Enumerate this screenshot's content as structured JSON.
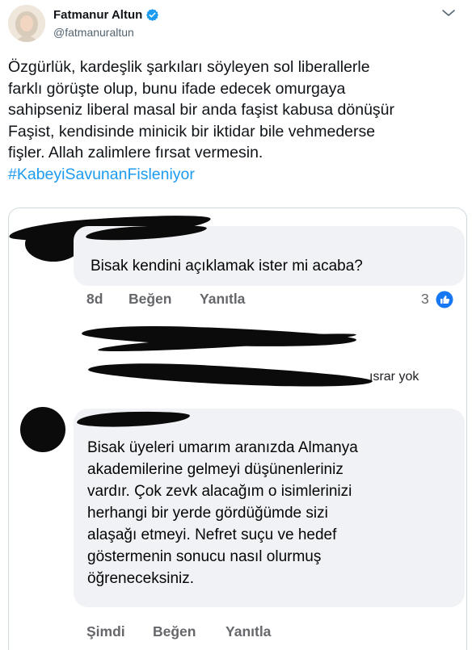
{
  "tweet": {
    "author_name": "Fatmanur Altun",
    "author_handle": "@fatmanuraltun",
    "lines": [
      "Özgürlük, kardeşlik şarkıları söyleyen sol liberallerle",
      "farklı görüşte olup, bunu ifade edecek omurgaya",
      "sahipseniz liberal masal bir anda faşist kabusa dönüşür",
      "Faşist, kendisinde minicik bir iktidar bile vehmederse",
      "fişler. Allah zalimlere fırsat vermesin."
    ],
    "hashtag": "#KabeyiSavunanFisleniyor"
  },
  "screenshot": {
    "comment1": {
      "text": "Bisak kendini açıklamak ister mi acaba?",
      "time": "8d",
      "like_label": "Beğen",
      "reply_label": "Yanıtla",
      "reaction_count": "3"
    },
    "reply_tail": "ısrar yok",
    "comment2": {
      "lines": [
        "Bisak üyeleri umarım aranızda Almanya",
        "akademilerine gelmeyi düşünenleriniz",
        "vardır. Çok zevk alacağım o isimlerinizi",
        "herhangi bir yerde gördüğümde sizi",
        "alaşağı etmeyi. Nefret suçu ve hedef",
        "göstermenin sonucu nasıl olurmuş",
        "öğreneceksiniz."
      ],
      "time": "Şimdi",
      "like_label": "Beğen",
      "reply_label": "Yanıtla"
    }
  },
  "colors": {
    "link": "#1d9bf0",
    "verified": "#1d9bf0",
    "fb_like": "#1877f2",
    "bubble": "#f0f2f5"
  },
  "icons": [
    "verified-badge-icon",
    "more-options-icon",
    "like-reaction-icon"
  ]
}
